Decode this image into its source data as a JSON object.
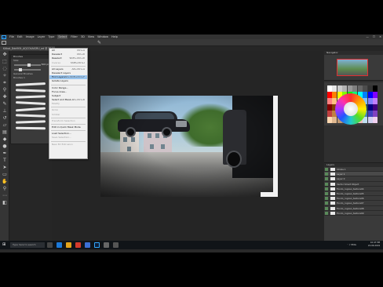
{
  "app": {
    "doc_tab": "Kitkat_Ddd9i5t_AQCO4AlGRU_ed @ 33.2% (Stroke 1, RGB/8#) *",
    "window_buttons": [
      "—",
      "☐",
      "✕"
    ]
  },
  "menubar": {
    "logo": "Ps",
    "items": [
      "File",
      "Edit",
      "Image",
      "Layer",
      "Type",
      "Select",
      "Filter",
      "3D",
      "View",
      "Window",
      "Help"
    ],
    "active": "Select"
  },
  "select_menu": {
    "items": [
      {
        "label": "All",
        "shortcut": "Ctrl+A",
        "state": "normal"
      },
      {
        "label": "Deselect",
        "shortcut": "Ctrl+D",
        "state": "normal"
      },
      {
        "label": "Reselect",
        "shortcut": "Shift+Ctrl+D",
        "state": "normal"
      },
      {
        "label": "Inverse",
        "shortcut": "Shift+Ctrl+I",
        "state": "disabled"
      },
      {
        "sep": true
      },
      {
        "label": "All Layers",
        "shortcut": "Alt+Ctrl+A",
        "state": "normal"
      },
      {
        "label": "Deselect Layers",
        "shortcut": "",
        "state": "normal"
      },
      {
        "label": "Find Layers",
        "shortcut": "Alt+Shift+Ctrl+F",
        "state": "highlighted"
      },
      {
        "label": "Isolate Layers",
        "shortcut": "",
        "state": "normal"
      },
      {
        "sep": true
      },
      {
        "label": "Color Range...",
        "shortcut": "",
        "state": "normal"
      },
      {
        "label": "Focus Area...",
        "shortcut": "",
        "state": "normal"
      },
      {
        "label": "Subject",
        "shortcut": "",
        "state": "normal"
      },
      {
        "label": "Select and Mask...",
        "shortcut": "Alt+Ctrl+R",
        "state": "normal"
      },
      {
        "label": "Modify",
        "shortcut": "",
        "state": "disabled"
      },
      {
        "sep": true
      },
      {
        "label": "Grow",
        "shortcut": "",
        "state": "disabled"
      },
      {
        "label": "Similar",
        "shortcut": "",
        "state": "disabled"
      },
      {
        "sep": true
      },
      {
        "label": "Transform Selection",
        "shortcut": "",
        "state": "disabled"
      },
      {
        "sep": true
      },
      {
        "label": "Edit in Quick Mask Mode",
        "shortcut": "",
        "state": "normal"
      },
      {
        "sep": true
      },
      {
        "label": "Load Selection...",
        "shortcut": "",
        "state": "normal"
      },
      {
        "label": "Save Selection...",
        "shortcut": "",
        "state": "disabled"
      },
      {
        "sep": true
      },
      {
        "label": "New 3D Extrusion",
        "shortcut": "",
        "state": "disabled"
      }
    ]
  },
  "brush_panel": {
    "title": "Brushes",
    "size_label": "Size:",
    "size_value": "500 px",
    "folder": "General Brushes",
    "preset_folder": "Brushes 1",
    "slider_levels": [
      0.55,
      0.2
    ]
  },
  "navigator": {
    "title": "Navigator"
  },
  "swatches": {
    "colors": [
      "#ffffff",
      "#e6e6e6",
      "#cccccc",
      "#b3b3b3",
      "#999999",
      "#808080",
      "#666666",
      "#4d4d4d",
      "#333333",
      "#000000",
      "#ff0000",
      "#ff8000",
      "#ffff00",
      "#80ff00",
      "#00ff00",
      "#00ff80",
      "#00ffff",
      "#0080ff",
      "#0000ff",
      "#8000ff",
      "#ff8080",
      "#ffc080",
      "#ffff80",
      "#c0ff80",
      "#80ff80",
      "#80ffc0",
      "#80ffff",
      "#80c0ff",
      "#8080ff",
      "#c080ff",
      "#800000",
      "#804000",
      "#808000",
      "#408000",
      "#008000",
      "#008040",
      "#008080",
      "#004080",
      "#000080",
      "#400080",
      "#c04040",
      "#c08040",
      "#c0c040",
      "#80c040",
      "#40c040",
      "#40c080",
      "#40c0c0",
      "#4080c0",
      "#4040c0",
      "#8040c0",
      "#ffd8b0",
      "#e0b890",
      "#c09870",
      "#a07850",
      "#805830",
      "#604020",
      "#f0c0c0",
      "#c0e0f0",
      "#d0d0f0",
      "#f0d0f0"
    ]
  },
  "layers": {
    "title": "Layers",
    "rows": [
      {
        "name": "Stroke 1",
        "selected": false,
        "visible": true
      },
      {
        "name": "Layer 1",
        "selected": true,
        "visible": true
      },
      {
        "name": "Layer 0",
        "selected": false,
        "visible": true
      },
      {
        "name": "Vector Smart Object",
        "selected": false,
        "visible": true
      },
      {
        "name": "Fondo_rugoso_textura04",
        "selected": false,
        "visible": true
      },
      {
        "name": "Fondo_rugoso_textura05",
        "selected": false,
        "visible": true
      },
      {
        "name": "Fondo_rugoso_textura06",
        "selected": false,
        "visible": true
      },
      {
        "name": "Fondo_rugoso_textura07",
        "selected": false,
        "visible": true
      },
      {
        "name": "Fondo_rugoso_textura08",
        "selected": false,
        "visible": true
      },
      {
        "name": "Fondo_rugoso_textura09",
        "selected": false,
        "visible": true
      }
    ]
  },
  "statusbar": {
    "text": "33.33%   Doc: 16.3M/254.4M"
  },
  "taskbar": {
    "start": "⊞",
    "search_placeholder": "Type here to search",
    "tray_icons": "ˆ  ♪  ENG",
    "time": "10:47 PM",
    "date": "22-09-2019"
  }
}
